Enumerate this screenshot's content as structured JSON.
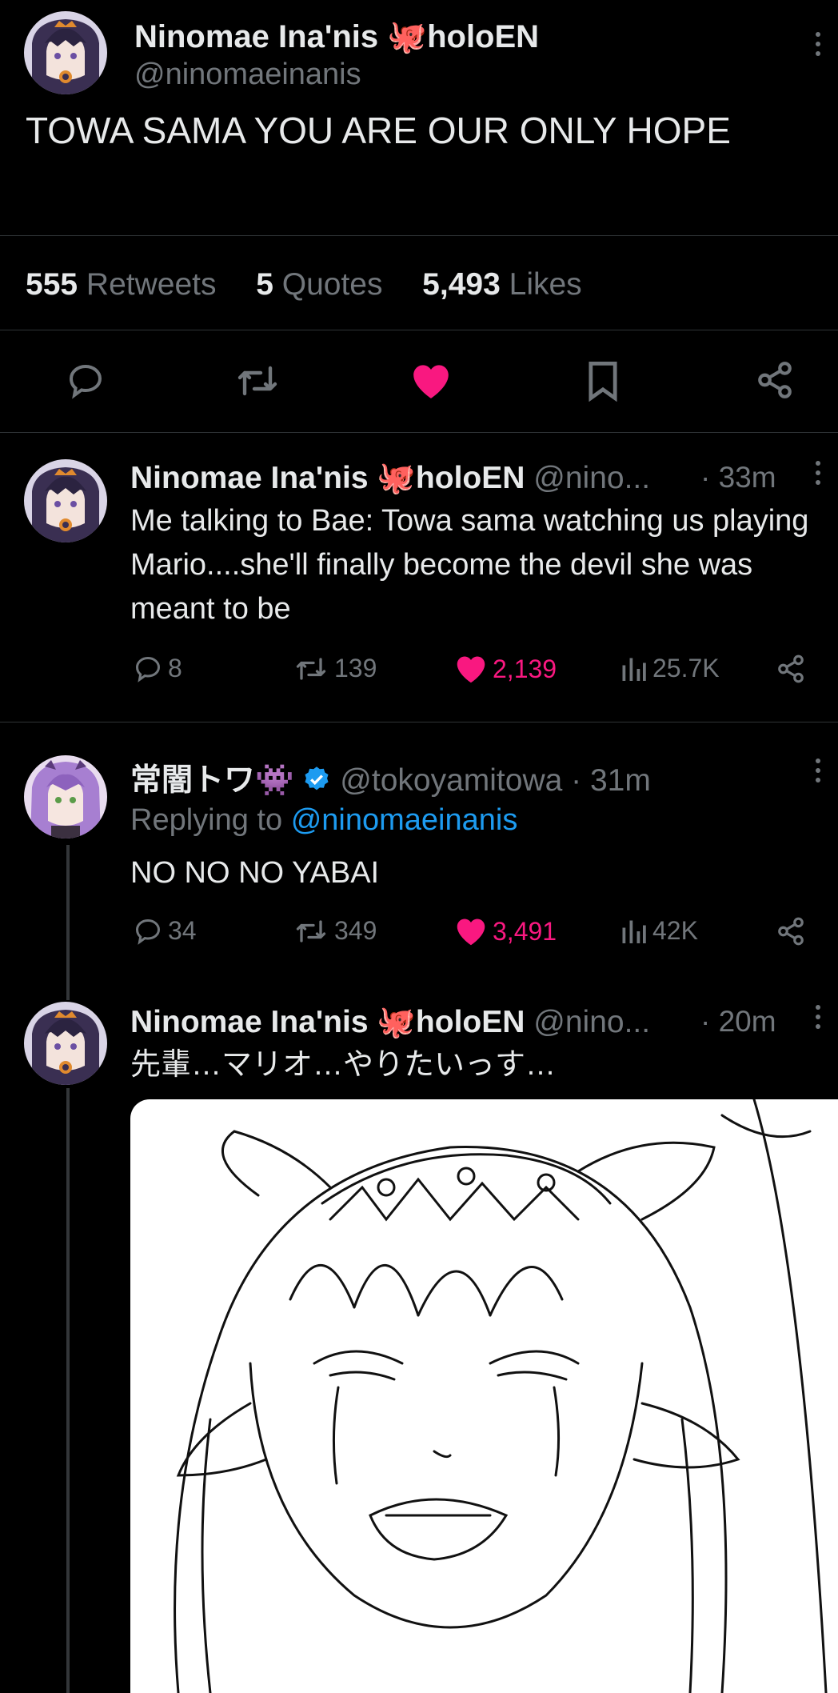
{
  "main_tweet": {
    "author_name": "Ninomae Ina'nis",
    "author_emoji": "🐙",
    "author_suffix": "holoEN",
    "handle": "@ninomaeinanis",
    "text": "TOWA SAMA YOU ARE OUR ONLY HOPE",
    "stats": {
      "retweets_count": "555",
      "retweets_label": "Retweets",
      "quotes_count": "5",
      "quotes_label": "Quotes",
      "likes_count": "5,493",
      "likes_label": "Likes"
    }
  },
  "replies": [
    {
      "author_name": "Ninomae Ina'nis",
      "author_emoji": "🐙",
      "author_suffix": "holoEN",
      "handle": "@nino...",
      "time": "· 33m",
      "text": "Me talking to Bae: Towa sama watching us playing Mario....she'll finally become the devil she was meant to be",
      "replies": "8",
      "retweets": "139",
      "likes": "2,139",
      "views": "25.7K"
    },
    {
      "author_name": "常闇トワ",
      "author_emoji": "👾",
      "handle": "@tokoyamitowa",
      "time": "· 31m",
      "replying_label": "Replying to",
      "replying_handle": "@ninomaeinanis",
      "text": "NO NO NO YABAI",
      "replies": "34",
      "retweets": "349",
      "likes": "3,491",
      "views": "42K"
    },
    {
      "author_name": "Ninomae Ina'nis",
      "author_emoji": "🐙",
      "author_suffix": "holoEN",
      "handle": "@nino...",
      "time": "· 20m",
      "text": "先輩…マリオ…やりたいっす…"
    }
  ],
  "colors": {
    "background": "#000000",
    "text": "#e7e9ea",
    "muted": "#71767b",
    "like": "#f91880",
    "link": "#1d9bf0",
    "verified": "#1d9bf0"
  }
}
